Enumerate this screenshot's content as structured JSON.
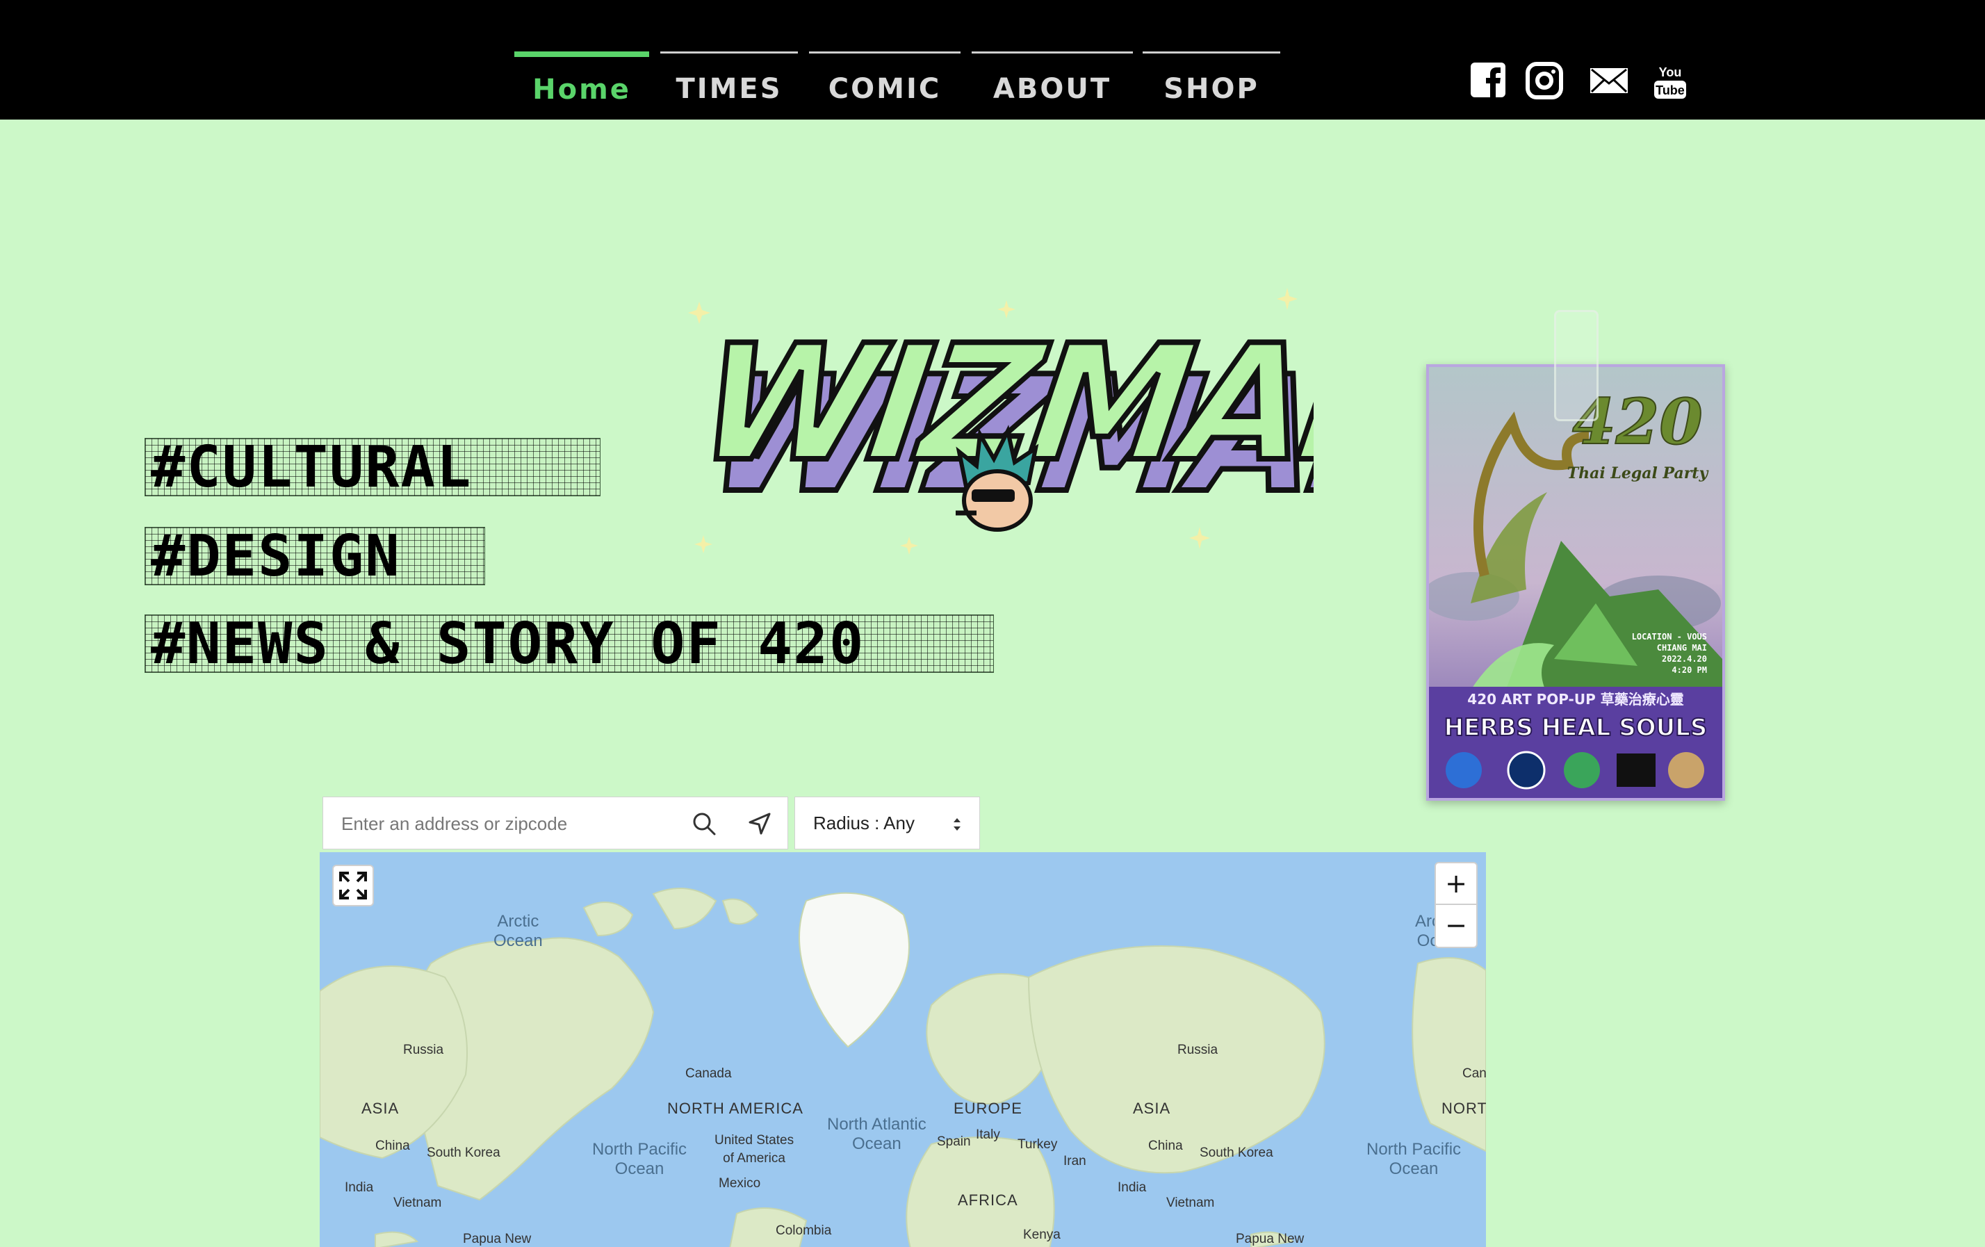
{
  "nav": {
    "tabs": [
      {
        "label": "Home",
        "active": true
      },
      {
        "label": "TIMES",
        "active": false
      },
      {
        "label": "COMIC",
        "active": false
      },
      {
        "label": "ABOUT",
        "active": false
      },
      {
        "label": "SHOP",
        "active": false
      }
    ],
    "active_color": "#5ad46a",
    "social_icons": [
      "facebook-icon",
      "instagram-icon",
      "mail-icon",
      "youtube-icon"
    ]
  },
  "hero": {
    "tags": [
      "#CULTURAL",
      "#DESIGN",
      "#NEWS & STORY OF 420"
    ],
    "logo_text": "WIZMAN"
  },
  "poster": {
    "title": "420",
    "subtitle": "Thai Legal Party",
    "location_line1": "LOCATION - VOUS",
    "location_line2": "CHIANG MAI",
    "date": "2022.4.20",
    "time": "4:20 PM",
    "event_line": "420 ART POP-UP 草藥治療心靈",
    "headline": "HERBS HEAL SOULS"
  },
  "search": {
    "placeholder": "Enter an address or zipcode",
    "radius_label": "Radius : Any"
  },
  "map": {
    "labels": {
      "arctic_ocean_1": "Arctic",
      "arctic_ocean_2": "Ocean",
      "arctic_ocean_right": "Arc",
      "arctic_ocean_right_2": "Oc",
      "russia_left": "Russia",
      "russia_right": "Russia",
      "canada": "Canada",
      "canada_right": "Cana",
      "asia_left": "ASIA",
      "asia_right": "ASIA",
      "north_america": "NORTH AMERICA",
      "north_right": "NORTH",
      "europe": "EUROPE",
      "china_left": "China",
      "china_right": "China",
      "south_korea_left": "South Korea",
      "south_korea_right": "South Korea",
      "north_pacific_1": "North Pacific",
      "north_pacific_2": "Ocean",
      "north_pacific_right_1": "North Pacific",
      "north_pacific_right_2": "Ocean",
      "united_states_1": "United States",
      "united_states_2": "of America",
      "north_atlantic_1": "North Atlantic",
      "north_atlantic_2": "Ocean",
      "spain": "Spain",
      "italy": "Italy",
      "turkey": "Turkey",
      "iran": "Iran",
      "india_left": "India",
      "india_right": "India",
      "vietnam_left": "Vietnam",
      "vietnam_right": "Vietnam",
      "mexico": "Mexico",
      "africa": "AFRICA",
      "papua_left": "Papua New",
      "papua_right": "Papua New",
      "colombia": "Colombia",
      "kenya": "Kenya"
    },
    "zoom_in": "+",
    "zoom_out": "−"
  }
}
